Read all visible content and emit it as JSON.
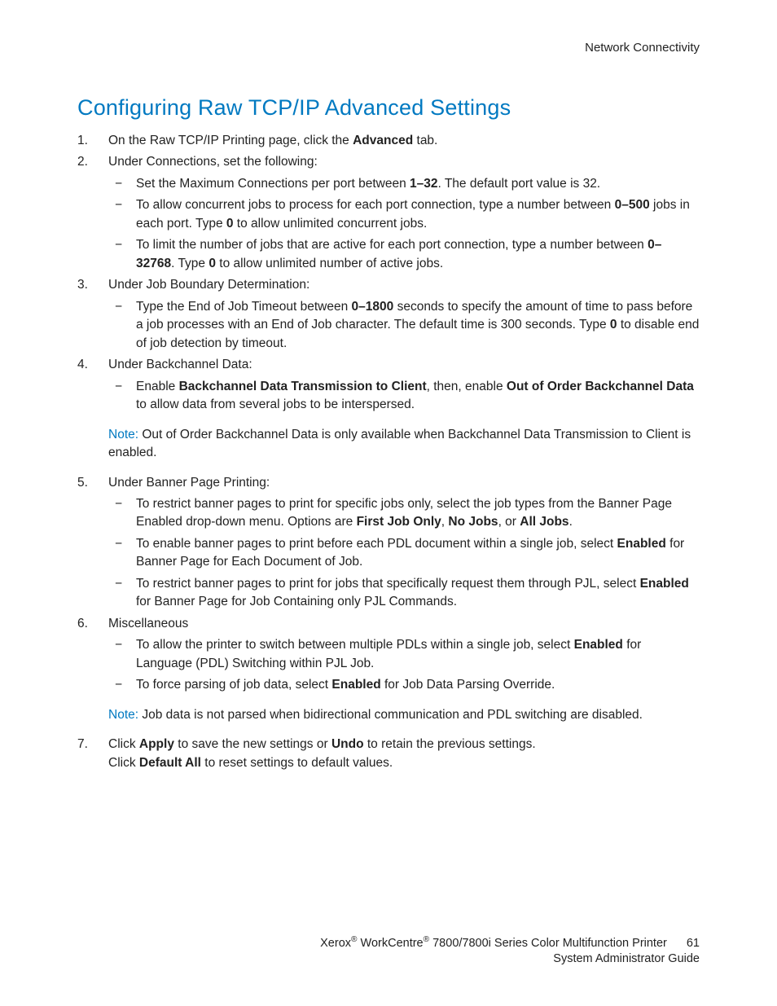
{
  "header": {
    "section": "Network Connectivity"
  },
  "title": "Configuring Raw TCP/IP Advanced Settings",
  "steps": {
    "s1": {
      "pre": "On the Raw TCP/IP Printing page, click the ",
      "b1": "Advanced",
      "post": " tab."
    },
    "s2": {
      "text": "Under Connections, set the following:",
      "a": {
        "pre": "Set the Maximum Connections per port between ",
        "b1": "1–32",
        "post": ". The default port value is 32."
      },
      "b": {
        "pre": "To allow concurrent jobs to process for each port connection, type a number between ",
        "b1": "0–500",
        "mid": " jobs in each port. Type ",
        "b2": "0",
        "post": " to allow unlimited concurrent jobs."
      },
      "c": {
        "pre": "To limit the number of jobs that are active for each port connection, type a number between ",
        "b1": "0–32768",
        "mid": ". Type ",
        "b2": "0",
        "post": " to allow unlimited number of active jobs."
      }
    },
    "s3": {
      "text": "Under Job Boundary Determination:",
      "a": {
        "pre": "Type the End of Job Timeout between ",
        "b1": "0–1800",
        "mid": " seconds to specify the amount of time to pass before a job processes with an End of Job character. The default time is 300 seconds. Type ",
        "b2": "0",
        "post": " to disable end of job detection by timeout."
      }
    },
    "s4": {
      "text": "Under Backchannel Data:",
      "a": {
        "pre": "Enable ",
        "b1": "Backchannel Data Transmission to Client",
        "mid": ", then, enable ",
        "b2": "Out of Order Backchannel Data",
        "post": " to allow data from several jobs to be interspersed."
      }
    },
    "note1": {
      "label": "Note:",
      "text": " Out of Order Backchannel Data is only available when Backchannel Data Transmission to Client is enabled."
    },
    "s5": {
      "text": "Under Banner Page Printing:",
      "a": {
        "pre": "To restrict banner pages to print for specific jobs only, select the job types from the Banner Page Enabled drop-down menu. Options are ",
        "b1": "First Job Only",
        "c1": ", ",
        "b2": "No Jobs",
        "c2": ", or ",
        "b3": "All Jobs",
        "post": "."
      },
      "b": {
        "pre": "To enable banner pages to print before each PDL document within a single job, select ",
        "b1": "Enabled",
        "post": " for Banner Page for Each Document of Job."
      },
      "c": {
        "pre": "To restrict banner pages to print for jobs that specifically request them through PJL, select ",
        "b1": "Enabled",
        "post": " for Banner Page for Job Containing only PJL Commands."
      }
    },
    "s6": {
      "text": "Miscellaneous",
      "a": {
        "pre": "To allow the printer to switch between multiple PDLs within a single job, select ",
        "b1": "Enabled",
        "post": " for Language (PDL) Switching within PJL Job."
      },
      "b": {
        "pre": "To force parsing of job data, select ",
        "b1": "Enabled",
        "post": " for Job Data Parsing Override."
      }
    },
    "note2": {
      "label": "Note:",
      "text": " Job data is not parsed when bidirectional communication and PDL switching are disabled."
    },
    "s7": {
      "line1": {
        "pre": "Click ",
        "b1": "Apply",
        "mid": " to save the new settings or ",
        "b2": "Undo",
        "post": " to retain the previous settings."
      },
      "line2": {
        "pre": "Click ",
        "b1": "Default All",
        "post": " to reset settings to default values."
      }
    }
  },
  "footer": {
    "brand_pre": "Xerox",
    "brand_mid": " WorkCentre",
    "brand_post": " 7800/7800i Series Color Multifunction Printer",
    "line2": "System Administrator Guide",
    "page": "61"
  }
}
